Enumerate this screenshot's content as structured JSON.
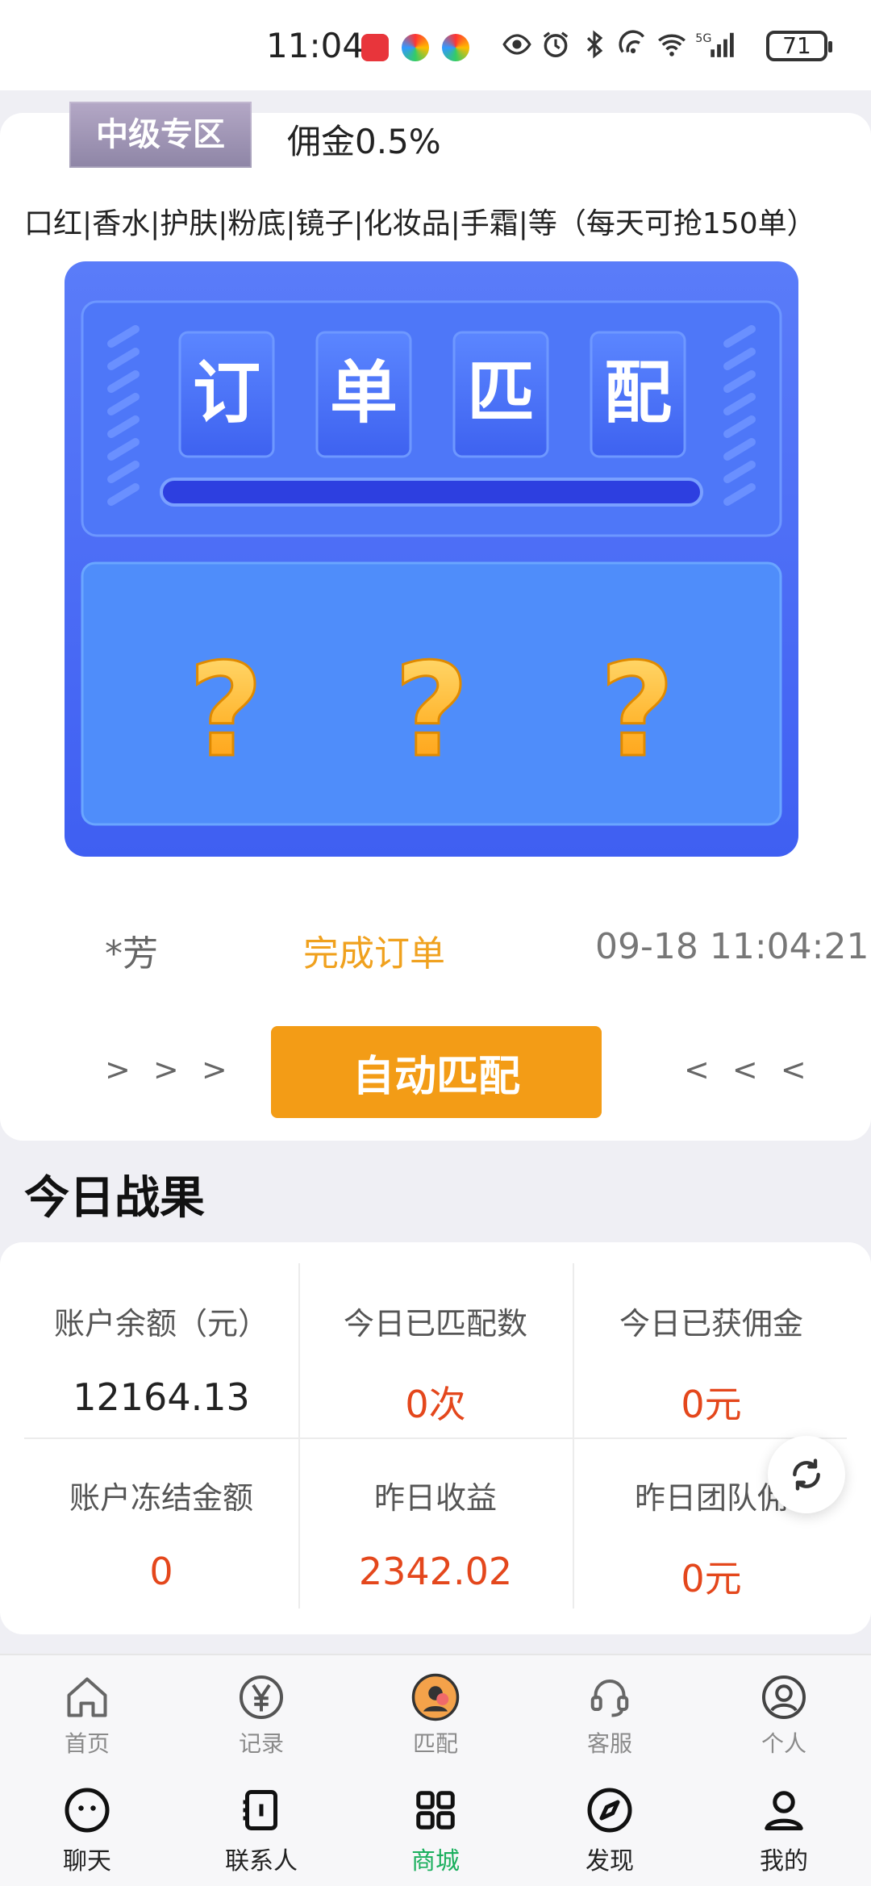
{
  "status_bar": {
    "time": "11:04",
    "battery": "71",
    "icons": [
      "huawei-store-icon",
      "app-icon",
      "app-icon",
      "eye-icon",
      "alarm-icon",
      "bluetooth-icon",
      "nfc-icon",
      "wifi-icon",
      "5g-signal-icon"
    ]
  },
  "tier": {
    "badge": "中级专区",
    "commission": "佣金0.5%",
    "products": "口红|香水|护肤|粉底|镜子|化妆品|手霜|等（每天可抢150单）"
  },
  "machine": {
    "chars": [
      "订",
      "单",
      "匹",
      "配"
    ],
    "slots": [
      "?",
      "?",
      "?"
    ]
  },
  "recent_match": {
    "name": "*芳",
    "status": "完成订单",
    "time": "09-18 11:04:21"
  },
  "auto_match": {
    "left_arrows": "> > >",
    "button": "自动匹配",
    "right_arrows": "< < <"
  },
  "today": {
    "title": "今日战果",
    "stats": [
      {
        "label": "账户余额（元）",
        "value": "12164.13"
      },
      {
        "label": "今日已匹配数",
        "value": "0次"
      },
      {
        "label": "今日已获佣金",
        "value": "0元"
      },
      {
        "label": "账户冻结金额",
        "value": "0"
      },
      {
        "label": "昨日收益",
        "value": "2342.02"
      },
      {
        "label": "昨日团队佣",
        "value": "0元"
      }
    ]
  },
  "app_tabs": [
    {
      "label": "首页",
      "icon": "home-icon"
    },
    {
      "label": "记录",
      "icon": "yen-icon"
    },
    {
      "label": "匹配",
      "icon": "match-avatar-icon"
    },
    {
      "label": "客服",
      "icon": "headset-icon"
    },
    {
      "label": "个人",
      "icon": "user-icon"
    }
  ],
  "host_tabs": [
    {
      "label": "聊天",
      "icon": "chat-icon"
    },
    {
      "label": "联系人",
      "icon": "contacts-icon"
    },
    {
      "label": "商城",
      "icon": "grid-icon"
    },
    {
      "label": "发现",
      "icon": "compass-icon"
    },
    {
      "label": "我的",
      "icon": "person-icon"
    }
  ],
  "colors": {
    "accent_orange": "#f39c16",
    "value_red": "#e4471c",
    "machine_blue": "#4a6cf7",
    "active_green": "#1aaf5d"
  }
}
